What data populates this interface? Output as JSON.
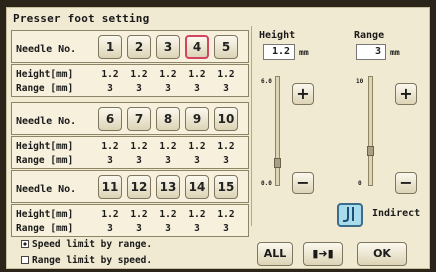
{
  "title": "Presser foot setting",
  "needle_label": "Needle No.",
  "height_row_label": "Height[mm]",
  "range_row_label": "Range [mm]",
  "groups": [
    {
      "needles": [
        "1",
        "2",
        "3",
        "4",
        "5"
      ],
      "heights": [
        "1.2",
        "1.2",
        "1.2",
        "1.2",
        "1.2"
      ],
      "ranges": [
        "3",
        "3",
        "3",
        "3",
        "3"
      ]
    },
    {
      "needles": [
        "6",
        "7",
        "8",
        "9",
        "10"
      ],
      "heights": [
        "1.2",
        "1.2",
        "1.2",
        "1.2",
        "1.2"
      ],
      "ranges": [
        "3",
        "3",
        "3",
        "3",
        "3"
      ]
    },
    {
      "needles": [
        "11",
        "12",
        "13",
        "14",
        "15"
      ],
      "heights": [
        "1.2",
        "1.2",
        "1.2",
        "1.2",
        "1.2"
      ],
      "ranges": [
        "3",
        "3",
        "3",
        "3",
        "3"
      ]
    }
  ],
  "selected_needle": "4",
  "options": {
    "speed_limit": "Speed limit by range.",
    "range_limit": "Range limit by speed."
  },
  "height": {
    "label": "Height",
    "value": "1.2",
    "unit": "mm",
    "max": "6.0",
    "min": "0.0",
    "plus": "+",
    "minus": "−"
  },
  "range": {
    "label": "Range",
    "value": "3",
    "unit": "mm",
    "max": "10",
    "min": "0",
    "plus": "+",
    "minus": "−"
  },
  "indirect_label": "Indirect",
  "buttons": {
    "all": "ALL",
    "copy": "▮➜▮",
    "ok": "OK"
  },
  "colors": {
    "background": "#f1ead2",
    "selected_border": "#d2445f",
    "indirect_fill": "#a8dcec"
  }
}
